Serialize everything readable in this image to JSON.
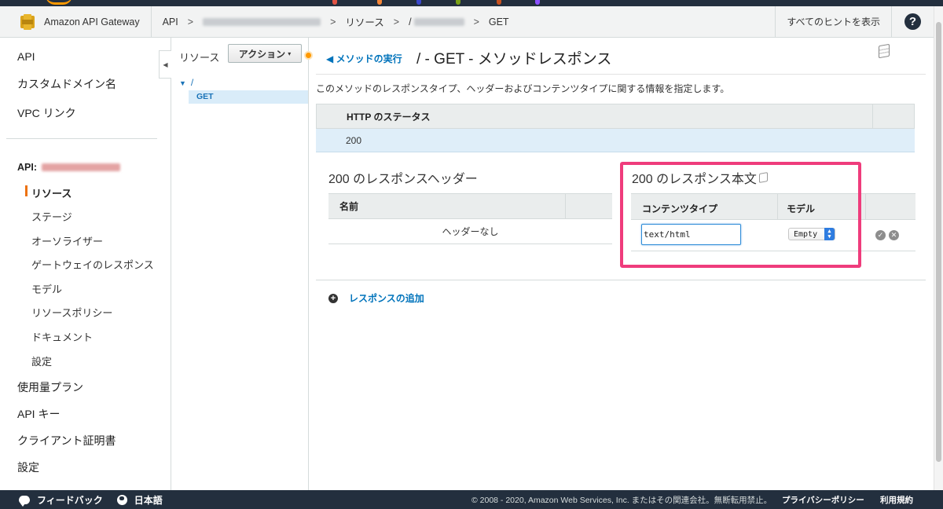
{
  "breadcrumb": {
    "service_name": "Amazon API Gateway",
    "api_label": "API",
    "resources_label": "リソース",
    "resource_path_prefix": "/",
    "method_label": "GET",
    "hints_label": "すべてのヒントを表示",
    "help_label": "?"
  },
  "nav": {
    "top_items": [
      "API",
      "カスタムドメイン名",
      "VPC リンク"
    ],
    "api_prefix": "API:",
    "sub_items": [
      "リソース",
      "ステージ",
      "オーソライザー",
      "ゲートウェイのレスポンス",
      "モデル",
      "リソースポリシー",
      "ドキュメント",
      "設定"
    ],
    "bottom_items": [
      "使用量プラン",
      "API キー",
      "クライアント証明書",
      "設定"
    ]
  },
  "resources": {
    "title": "リソース",
    "actions_label": "アクション",
    "tree_root": "/",
    "tree_method": "GET"
  },
  "main": {
    "back_link": "メソッドの実行",
    "page_title": "/ - GET - メソッドレスポンス",
    "description": "このメソッドのレスポンスタイプ、ヘッダーおよびコンテンツタイプに関する情報を指定します。",
    "status_header": "HTTP のステータス",
    "status_value": "200",
    "headers_title": "200 のレスポンスヘッダー",
    "headers_col_name": "名前",
    "headers_empty": "ヘッダーなし",
    "body_title": "200 のレスポンス本文",
    "body_col_content_type": "コンテンツタイプ",
    "body_col_model": "モデル",
    "content_type_value": "text/html",
    "model_value": "Empty",
    "add_response": "レスポンスの追加"
  },
  "footer": {
    "feedback": "フィードバック",
    "language": "日本語",
    "copyright": "© 2008 - 2020, Amazon Web Services, Inc. またはその関連会社。無断転用禁止。",
    "privacy": "プライバシーポリシー",
    "terms": "利用規約"
  },
  "colors": {
    "highlight": "#ef3c7c",
    "accent_orange": "#ec7211",
    "link_blue": "#0073bb",
    "selected_row": "#dfeef9"
  }
}
